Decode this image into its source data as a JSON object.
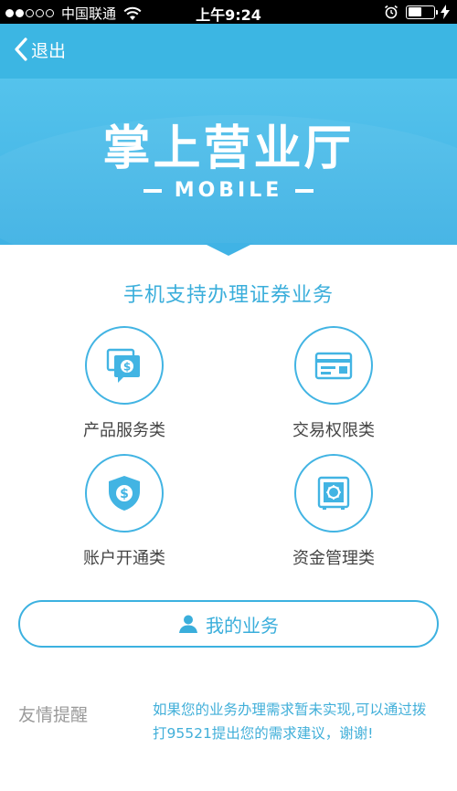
{
  "status_bar": {
    "carrier": "中国联通",
    "time": "上午9:24",
    "signal_bars_filled": 2,
    "signal_bars_total": 5,
    "battery_level": 0.55
  },
  "nav": {
    "back_label": "退出"
  },
  "banner": {
    "title": "掌上营业厅",
    "subtitle": "MOBILE"
  },
  "main": {
    "heading": "手机支持办理证券业务",
    "categories": [
      {
        "label": "产品服务类",
        "icon": "product-service-icon"
      },
      {
        "label": "交易权限类",
        "icon": "trade-permission-icon"
      },
      {
        "label": "账户开通类",
        "icon": "account-open-icon"
      },
      {
        "label": "资金管理类",
        "icon": "fund-management-icon"
      }
    ],
    "my_business_label": "我的业务"
  },
  "reminder": {
    "title": "友情提醒",
    "text": "如果您的业务办理需求暂未实现,可以通过拨打95521提出您的需求建议，谢谢!"
  },
  "colors": {
    "accent": "#3cb6e3",
    "text_gray": "#444444",
    "hint_gray": "#9a9a9a"
  }
}
